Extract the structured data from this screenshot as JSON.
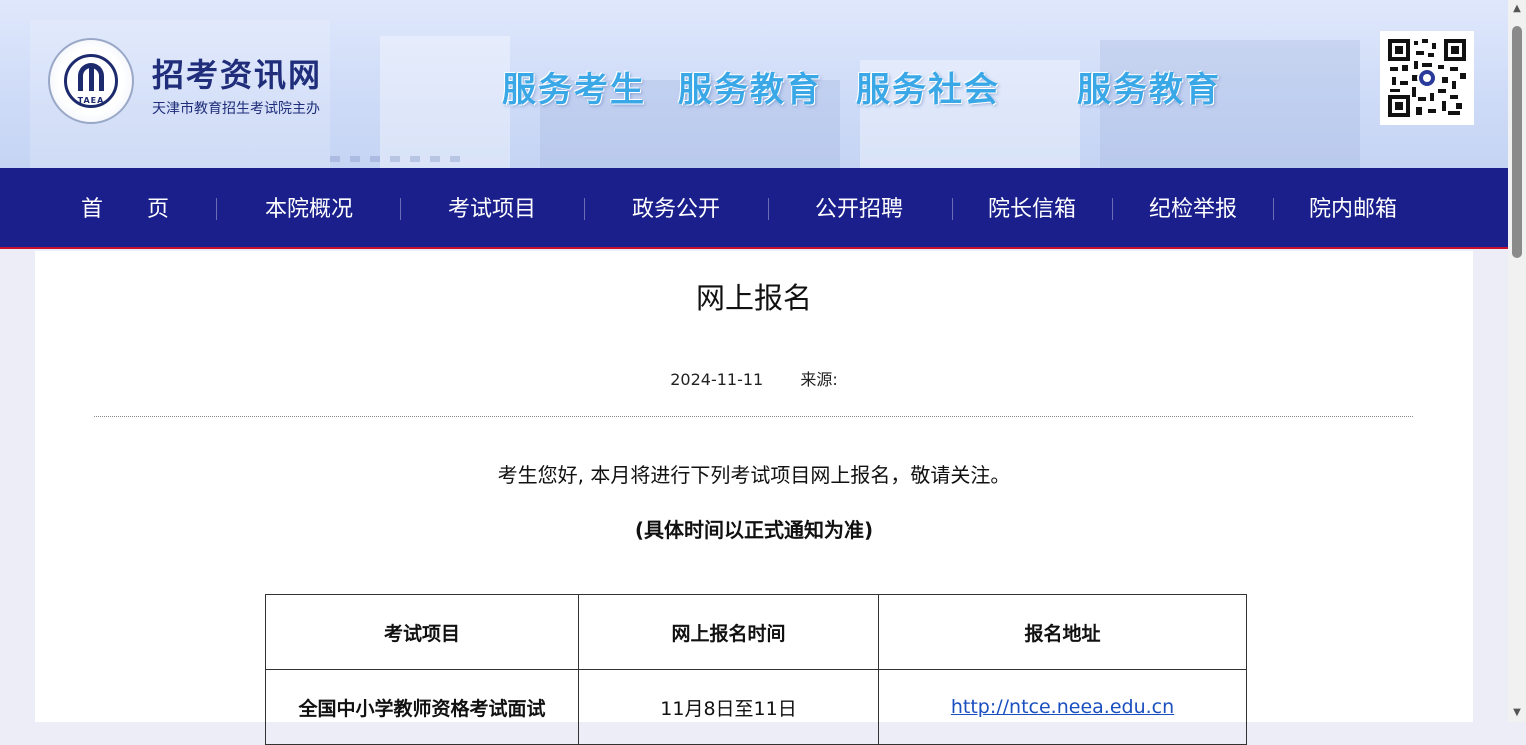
{
  "header": {
    "site_title": "招考资讯网",
    "site_subtitle": "天津市教育招生考试院主办",
    "logo_text": "TAEA",
    "slogans": [
      "服务考生",
      "服务教育",
      "服务社会",
      "服务教育"
    ],
    "qr_icon": "qr-code-icon"
  },
  "nav": {
    "items": [
      "首　　页",
      "本院概况",
      "考试项目",
      "政务公开",
      "公开招聘",
      "院长信箱",
      "纪检举报",
      "院内邮箱"
    ]
  },
  "article": {
    "title": "网上报名",
    "date": "2024-11-11",
    "source_label": "来源:",
    "intro": "考生您好, 本月将进行下列考试项目网上报名，敬请关注。",
    "note": "(具体时间以正式通知为准)"
  },
  "table": {
    "headers": [
      "考试项目",
      "网上报名时间",
      "报名地址"
    ],
    "rows": [
      {
        "project": "全国中小学教师资格考试面试",
        "time": "11月8日至11日",
        "url": "http://ntce.neea.edu.cn"
      }
    ]
  },
  "colors": {
    "nav_bg": "#1a1f8c",
    "nav_border": "#c8102e",
    "slogan": "#3aa7e6",
    "title_blue": "#1f2d7a",
    "link": "#1a4fc0"
  }
}
